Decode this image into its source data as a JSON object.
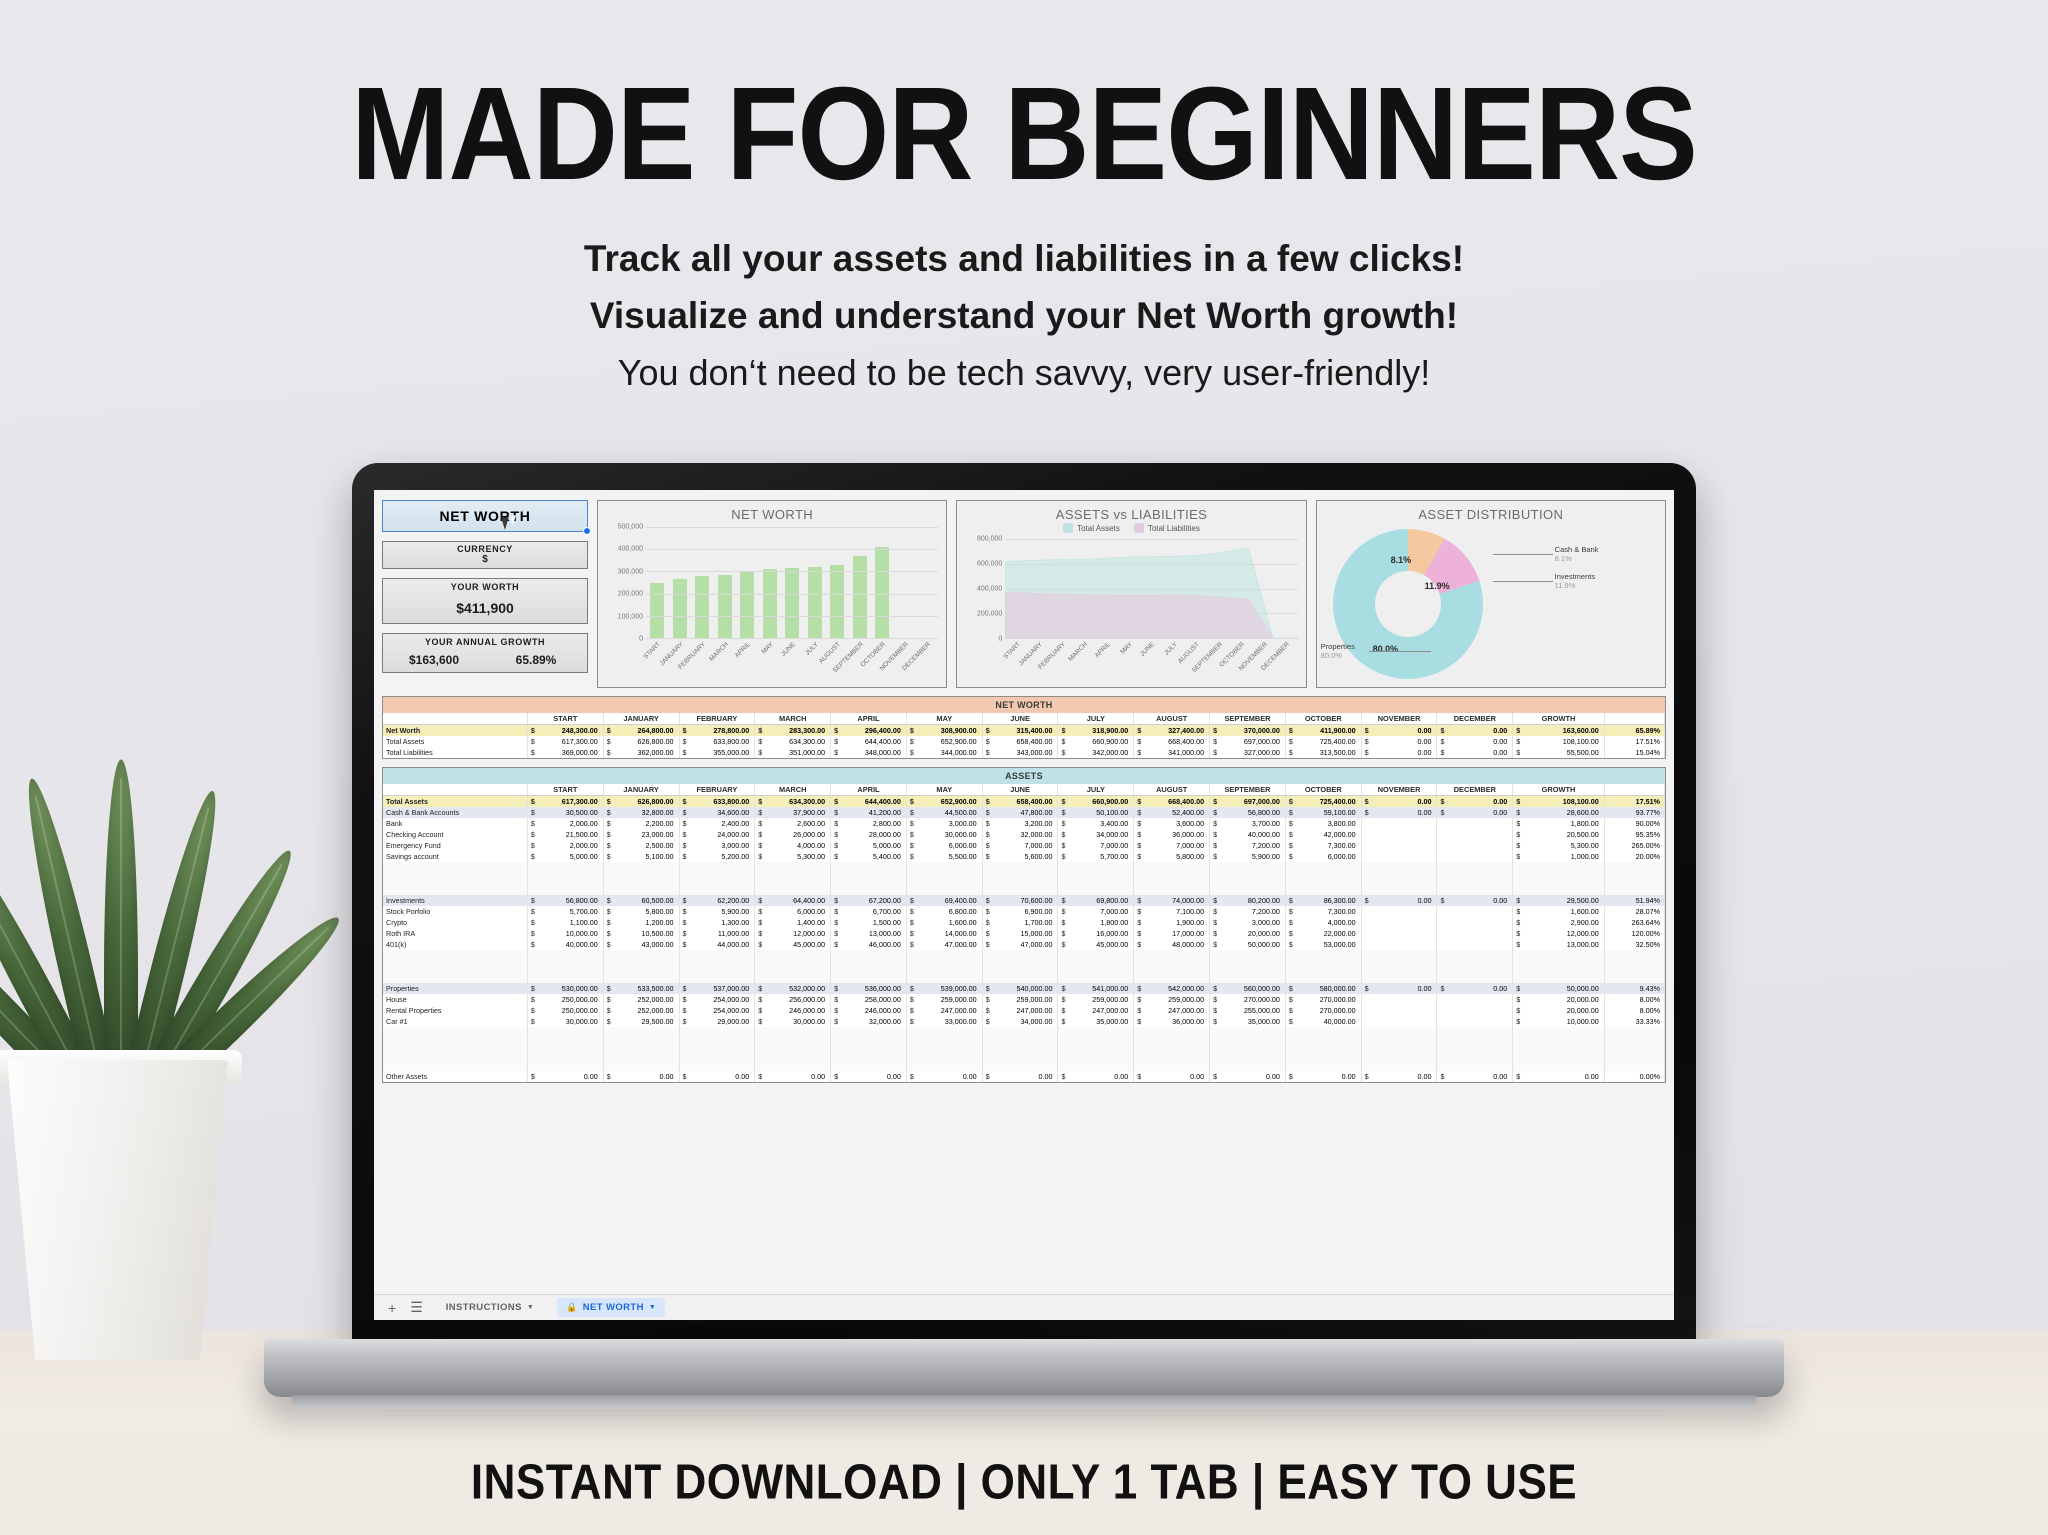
{
  "promo": {
    "headline": "MADE FOR BEGINNERS",
    "sub1": "Track all your assets and liabilities in a few clicks!",
    "sub2": "Visualize and understand your Net Worth growth!",
    "sub3": "You don‘t need to be tech savvy, very user-friendly!",
    "footer": "INSTANT DOWNLOAD  |  ONLY 1 TAB  |  EASY TO USE"
  },
  "sidebar": {
    "netWorthButton": "NET WORTH",
    "currencyLabel": "CURRENCY",
    "currencyValue": "$",
    "worthLabel": "YOUR WORTH",
    "worthValue": "$411,900",
    "growthLabel": "YOUR ANNUAL GROWTH",
    "growthValue": "$163,600",
    "growthPercent": "65.89%"
  },
  "tabbar": {
    "addLabel": "+",
    "menuLabel": "☰",
    "tabs": [
      {
        "label": "INSTRUCTIONS",
        "locked": false,
        "active": false
      },
      {
        "label": "NET WORTH",
        "locked": true,
        "active": true
      }
    ]
  },
  "chart_data": [
    {
      "type": "bar",
      "title": "NET WORTH",
      "categories": [
        "START",
        "JANUARY",
        "FEBRUARY",
        "MARCH",
        "APRIL",
        "MAY",
        "JUNE",
        "JULY",
        "AUGUST",
        "SEPTEMBER",
        "OCTOBER",
        "NOVEMBER",
        "DECEMBER"
      ],
      "values": [
        248300,
        264800,
        278800,
        283300,
        296400,
        308900,
        315400,
        318900,
        327400,
        370000,
        411900,
        0,
        0
      ],
      "ylim": [
        0,
        500000
      ],
      "yticks": [
        0,
        100000,
        200000,
        300000,
        400000,
        500000
      ],
      "ytick_labels": [
        "0",
        "100,000",
        "200,000",
        "300,000",
        "400,000",
        "500,000"
      ],
      "series_color": "#b6dfa8",
      "grid": true,
      "legend": "none"
    },
    {
      "type": "area",
      "title": "ASSETS vs LIABILITIES",
      "categories": [
        "START",
        "JANUARY",
        "FEBRUARY",
        "MARCH",
        "APRIL",
        "MAY",
        "JUNE",
        "JULY",
        "AUGUST",
        "SEPTEMBER",
        "OCTOBER",
        "NOVEMBER",
        "DECEMBER"
      ],
      "series": [
        {
          "name": "Total Assets",
          "color": "#bfe3e0",
          "values": [
            617300,
            626800,
            633800,
            634300,
            644400,
            652900,
            658400,
            660900,
            668400,
            697000,
            725400,
            0,
            0
          ]
        },
        {
          "name": "Total Liabilities",
          "color": "#e5c9dd",
          "values": [
            369000,
            362000,
            355000,
            351000,
            348000,
            344000,
            343000,
            342000,
            341000,
            327000,
            313500,
            0,
            0
          ]
        }
      ],
      "ylim": [
        0,
        800000
      ],
      "yticks": [
        0,
        200000,
        400000,
        600000,
        800000
      ],
      "ytick_labels": [
        "0",
        "200,000",
        "400,000",
        "600,000",
        "800,000"
      ],
      "grid": true,
      "legend": "top"
    },
    {
      "type": "pie",
      "title": "ASSET DISTRIBUTION",
      "labels": [
        "Cash & Bank",
        "Investments",
        "Properties"
      ],
      "values": [
        8.1,
        11.9,
        80.0
      ],
      "value_labels": [
        "8.1%",
        "11.9%",
        "80.0%"
      ],
      "colors": [
        "#f5c9a0",
        "#eeb2da",
        "#a8dde2"
      ],
      "donut": true,
      "legend": "callouts"
    }
  ],
  "netWorthTable": {
    "banner": "NET WORTH",
    "columns": [
      "",
      "START",
      "JANUARY",
      "FEBRUARY",
      "MARCH",
      "APRIL",
      "MAY",
      "JUNE",
      "JULY",
      "AUGUST",
      "SEPTEMBER",
      "OCTOBER",
      "NOVEMBER",
      "DECEMBER",
      "GROWTH",
      ""
    ],
    "rows": [
      {
        "style": "hi",
        "label": "Net Worth",
        "values": [
          "248,300.00",
          "264,800.00",
          "278,800.00",
          "283,300.00",
          "296,400.00",
          "308,900.00",
          "315,400.00",
          "318,900.00",
          "327,400.00",
          "370,000.00",
          "411,900.00",
          "0.00",
          "0.00"
        ],
        "growth": "163,600.00",
        "pct": "65.89%"
      },
      {
        "style": "plain",
        "label": "Total Assets",
        "values": [
          "617,300.00",
          "626,800.00",
          "633,800.00",
          "634,300.00",
          "644,400.00",
          "652,900.00",
          "658,400.00",
          "660,900.00",
          "668,400.00",
          "697,000.00",
          "725,400.00",
          "0.00",
          "0.00"
        ],
        "growth": "108,100.00",
        "pct": "17.51%"
      },
      {
        "style": "plain",
        "label": "Total Liabilities",
        "values": [
          "369,000.00",
          "362,000.00",
          "355,000.00",
          "351,000.00",
          "348,000.00",
          "344,000.00",
          "343,000.00",
          "342,000.00",
          "341,000.00",
          "327,000.00",
          "313,500.00",
          "0.00",
          "0.00"
        ],
        "growth": "55,500.00",
        "pct": "15.04%"
      }
    ]
  },
  "assetsTable": {
    "banner": "ASSETS",
    "columns": [
      "",
      "START",
      "JANUARY",
      "FEBRUARY",
      "MARCH",
      "APRIL",
      "MAY",
      "JUNE",
      "JULY",
      "AUGUST",
      "SEPTEMBER",
      "OCTOBER",
      "NOVEMBER",
      "DECEMBER",
      "GROWTH",
      ""
    ],
    "rows": [
      {
        "style": "hi",
        "label": "Total Assets",
        "values": [
          "617,300.00",
          "626,800.00",
          "633,800.00",
          "634,300.00",
          "644,400.00",
          "652,900.00",
          "658,400.00",
          "660,900.00",
          "668,400.00",
          "697,000.00",
          "725,400.00",
          "0.00",
          "0.00"
        ],
        "growth": "108,100.00",
        "pct": "17.51%"
      },
      {
        "style": "sub",
        "label": "Cash & Bank Accounts",
        "values": [
          "30,500.00",
          "32,800.00",
          "34,600.00",
          "37,900.00",
          "41,200.00",
          "44,500.00",
          "47,800.00",
          "50,100.00",
          "52,400.00",
          "56,800.00",
          "59,100.00",
          "0.00",
          "0.00"
        ],
        "growth": "28,600.00",
        "pct": "93.77%"
      },
      {
        "style": "plain",
        "label": "Bank",
        "values": [
          "2,000.00",
          "2,200.00",
          "2,400.00",
          "2,600.00",
          "2,800.00",
          "3,000.00",
          "3,200.00",
          "3,400.00",
          "3,600.00",
          "3,700.00",
          "3,800.00",
          "",
          ""
        ],
        "growth": "1,800.00",
        "pct": "90.00%"
      },
      {
        "style": "plain",
        "label": "Checking Account",
        "values": [
          "21,500.00",
          "23,000.00",
          "24,000.00",
          "26,000.00",
          "28,000.00",
          "30,000.00",
          "32,000.00",
          "34,000.00",
          "36,000.00",
          "40,000.00",
          "42,000.00",
          "",
          ""
        ],
        "growth": "20,500.00",
        "pct": "95.35%"
      },
      {
        "style": "plain",
        "label": "Emergency Fund",
        "values": [
          "2,000.00",
          "2,500.00",
          "3,000.00",
          "4,000.00",
          "5,000.00",
          "6,000.00",
          "7,000.00",
          "7,000.00",
          "7,000.00",
          "7,200.00",
          "7,300.00",
          "",
          ""
        ],
        "growth": "5,300.00",
        "pct": "265.00%"
      },
      {
        "style": "plain",
        "label": "Savings account",
        "values": [
          "5,000.00",
          "5,100.00",
          "5,200.00",
          "5,300.00",
          "5,400.00",
          "5,500.00",
          "5,600.00",
          "5,700.00",
          "5,800.00",
          "5,900.00",
          "6,000.00",
          "",
          ""
        ],
        "growth": "1,000.00",
        "pct": "20.00%"
      },
      {
        "style": "blank",
        "label": "",
        "values": [
          "",
          "",
          "",
          "",
          "",
          "",
          "",
          "",
          "",
          "",
          "",
          "",
          ""
        ],
        "growth": "",
        "pct": ""
      },
      {
        "style": "blank",
        "label": "",
        "values": [
          "",
          "",
          "",
          "",
          "",
          "",
          "",
          "",
          "",
          "",
          "",
          "",
          ""
        ],
        "growth": "",
        "pct": ""
      },
      {
        "style": "blank",
        "label": "",
        "values": [
          "",
          "",
          "",
          "",
          "",
          "",
          "",
          "",
          "",
          "",
          "",
          "",
          ""
        ],
        "growth": "",
        "pct": ""
      },
      {
        "style": "sub",
        "label": "Investments",
        "values": [
          "56,800.00",
          "60,500.00",
          "62,200.00",
          "64,400.00",
          "67,200.00",
          "69,400.00",
          "70,600.00",
          "69,800.00",
          "74,000.00",
          "80,200.00",
          "86,300.00",
          "0.00",
          "0.00"
        ],
        "growth": "29,500.00",
        "pct": "51.94%"
      },
      {
        "style": "plain",
        "label": "Stock Porfolio",
        "values": [
          "5,700.00",
          "5,800.00",
          "5,900.00",
          "6,000.00",
          "6,700.00",
          "6,800.00",
          "6,900.00",
          "7,000.00",
          "7,100.00",
          "7,200.00",
          "7,300.00",
          "",
          ""
        ],
        "growth": "1,600.00",
        "pct": "28.07%"
      },
      {
        "style": "plain",
        "label": "Crypto",
        "values": [
          "1,100.00",
          "1,200.00",
          "1,300.00",
          "1,400.00",
          "1,500.00",
          "1,600.00",
          "1,700.00",
          "1,800.00",
          "1,900.00",
          "3,000.00",
          "4,000.00",
          "",
          ""
        ],
        "growth": "2,900.00",
        "pct": "263.64%"
      },
      {
        "style": "plain",
        "label": "Roth IRA",
        "values": [
          "10,000.00",
          "10,500.00",
          "11,000.00",
          "12,000.00",
          "13,000.00",
          "14,000.00",
          "15,000.00",
          "16,000.00",
          "17,000.00",
          "20,000.00",
          "22,000.00",
          "",
          ""
        ],
        "growth": "12,000.00",
        "pct": "120.00%"
      },
      {
        "style": "plain",
        "label": "401(k)",
        "values": [
          "40,000.00",
          "43,000.00",
          "44,000.00",
          "45,000.00",
          "46,000.00",
          "47,000.00",
          "47,000.00",
          "45,000.00",
          "48,000.00",
          "50,000.00",
          "53,000.00",
          "",
          ""
        ],
        "growth": "13,000.00",
        "pct": "32.50%"
      },
      {
        "style": "blank",
        "label": "",
        "values": [
          "",
          "",
          "",
          "",
          "",
          "",
          "",
          "",
          "",
          "",
          "",
          "",
          ""
        ],
        "growth": "",
        "pct": ""
      },
      {
        "style": "blank",
        "label": "",
        "values": [
          "",
          "",
          "",
          "",
          "",
          "",
          "",
          "",
          "",
          "",
          "",
          "",
          ""
        ],
        "growth": "",
        "pct": ""
      },
      {
        "style": "blank",
        "label": "",
        "values": [
          "",
          "",
          "",
          "",
          "",
          "",
          "",
          "",
          "",
          "",
          "",
          "",
          ""
        ],
        "growth": "",
        "pct": ""
      },
      {
        "style": "sub",
        "label": "Properties",
        "values": [
          "530,000.00",
          "533,500.00",
          "537,000.00",
          "532,000.00",
          "536,000.00",
          "539,000.00",
          "540,000.00",
          "541,000.00",
          "542,000.00",
          "560,000.00",
          "580,000.00",
          "0.00",
          "0.00"
        ],
        "growth": "50,000.00",
        "pct": "9.43%"
      },
      {
        "style": "plain",
        "label": "House",
        "values": [
          "250,000.00",
          "252,000.00",
          "254,000.00",
          "256,000.00",
          "258,000.00",
          "259,000.00",
          "259,000.00",
          "259,000.00",
          "259,000.00",
          "270,000.00",
          "270,000.00",
          "",
          ""
        ],
        "growth": "20,000.00",
        "pct": "8.00%"
      },
      {
        "style": "plain",
        "label": "Rental Properties",
        "values": [
          "250,000.00",
          "252,000.00",
          "254,000.00",
          "246,000.00",
          "246,000.00",
          "247,000.00",
          "247,000.00",
          "247,000.00",
          "247,000.00",
          "255,000.00",
          "270,000.00",
          "",
          ""
        ],
        "growth": "20,000.00",
        "pct": "8.00%"
      },
      {
        "style": "plain",
        "label": "Car #1",
        "values": [
          "30,000.00",
          "29,500.00",
          "29,000.00",
          "30,000.00",
          "32,000.00",
          "33,000.00",
          "34,000.00",
          "35,000.00",
          "36,000.00",
          "35,000.00",
          "40,000.00",
          "",
          ""
        ],
        "growth": "10,000.00",
        "pct": "33.33%"
      },
      {
        "style": "blank",
        "label": "",
        "values": [
          "",
          "",
          "",
          "",
          "",
          "",
          "",
          "",
          "",
          "",
          "",
          "",
          ""
        ],
        "growth": "",
        "pct": ""
      },
      {
        "style": "blank",
        "label": "",
        "values": [
          "",
          "",
          "",
          "",
          "",
          "",
          "",
          "",
          "",
          "",
          "",
          "",
          ""
        ],
        "growth": "",
        "pct": ""
      },
      {
        "style": "blank",
        "label": "",
        "values": [
          "",
          "",
          "",
          "",
          "",
          "",
          "",
          "",
          "",
          "",
          "",
          "",
          ""
        ],
        "growth": "",
        "pct": ""
      },
      {
        "style": "blank",
        "label": "",
        "values": [
          "",
          "",
          "",
          "",
          "",
          "",
          "",
          "",
          "",
          "",
          "",
          "",
          ""
        ],
        "growth": "",
        "pct": ""
      },
      {
        "style": "other",
        "label": "Other Assets",
        "values": [
          "0.00",
          "0.00",
          "0.00",
          "0.00",
          "0.00",
          "0.00",
          "0.00",
          "0.00",
          "0.00",
          "0.00",
          "0.00",
          "0.00",
          "0.00"
        ],
        "growth": "0.00",
        "pct": "0.00%"
      }
    ]
  }
}
